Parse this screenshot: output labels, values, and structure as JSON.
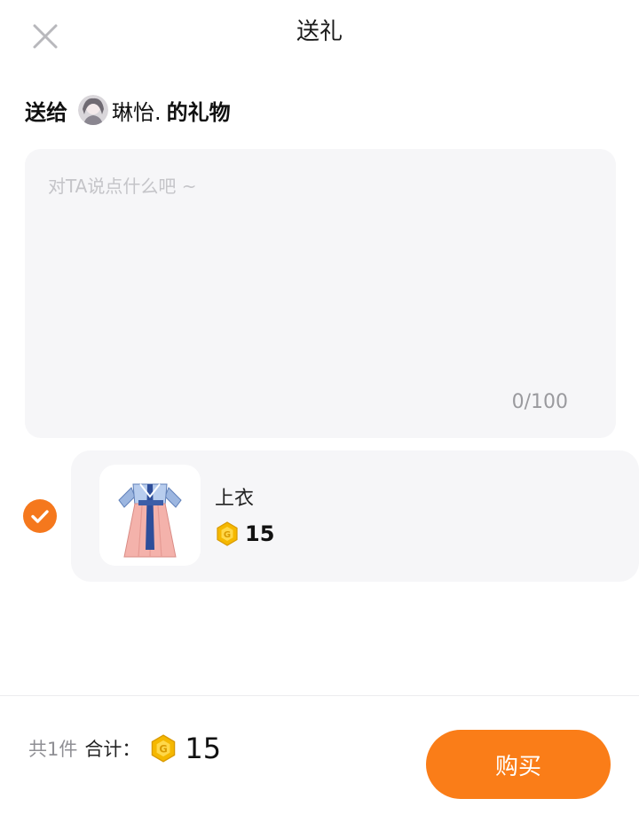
{
  "header": {
    "title": "送礼",
    "close_icon": "close-icon"
  },
  "recipient": {
    "prefix": "送给",
    "name": "琳怡.",
    "suffix": "的礼物"
  },
  "message": {
    "placeholder": "对TA说点什么吧 ~",
    "value": "",
    "char_count": "0/100"
  },
  "gift": {
    "selected": true,
    "name": "上衣",
    "price": "15",
    "currency_icon": "coin-icon"
  },
  "footer": {
    "count_text": "共1件",
    "sum_label": "合计：",
    "total": "15",
    "buy_label": "购买"
  },
  "colors": {
    "accent": "#fa7d18",
    "card_bg": "#f6f6f8",
    "coin": "#f5b800"
  }
}
